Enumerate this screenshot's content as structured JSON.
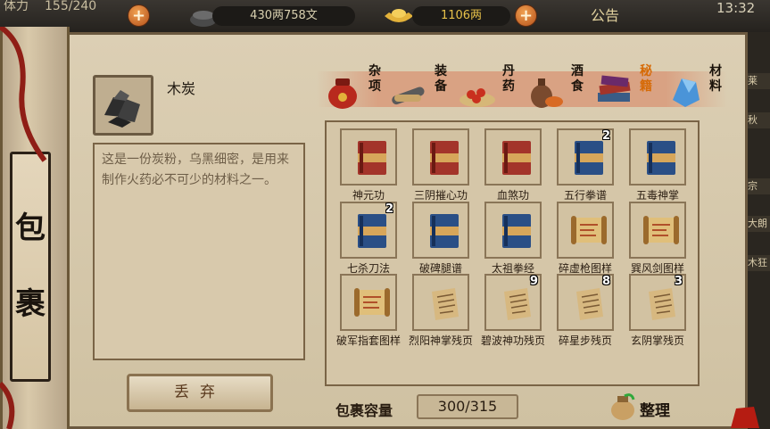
{
  "topbar": {
    "partial_label": "体力",
    "stamina": "155/240",
    "money": "430两758文",
    "ingots": "1106两",
    "notice_label": "公告",
    "clock": "13:32"
  },
  "scroll_title": [
    "包",
    "裹"
  ],
  "selected_item": {
    "name": "木炭",
    "description": "这是一份炭粉，乌黑细密，是用来制作火药必不可少的材料之一。"
  },
  "discard_label": "丢弃",
  "tabs": [
    {
      "label": "杂项",
      "icon": "red-jar-icon"
    },
    {
      "label": "装备",
      "icon": "scroll-bundle-icon"
    },
    {
      "label": "丹药",
      "icon": "pills-plate-icon"
    },
    {
      "label": "酒食",
      "icon": "wine-food-icon"
    },
    {
      "label": "秘籍",
      "icon": "manual-books-icon",
      "active": true
    },
    {
      "label": "材料",
      "icon": "blue-crystal-icon"
    }
  ],
  "items": [
    {
      "name": "神元功",
      "count": "",
      "type": "red-book"
    },
    {
      "name": "三阴摧心功",
      "count": "",
      "type": "red-book"
    },
    {
      "name": "血煞功",
      "count": "",
      "type": "red-book"
    },
    {
      "name": "五行拳谱",
      "count": "2",
      "type": "blue-book"
    },
    {
      "name": "五毒神掌",
      "count": "",
      "type": "blue-book"
    },
    {
      "name": "七杀刀法",
      "count": "2",
      "type": "blue-book"
    },
    {
      "name": "破碑腿谱",
      "count": "",
      "type": "blue-book"
    },
    {
      "name": "太祖拳经",
      "count": "",
      "type": "blue-book"
    },
    {
      "name": "碎虚枪图样",
      "count": "",
      "type": "scroll"
    },
    {
      "name": "巽风剑图样",
      "count": "",
      "type": "scroll"
    },
    {
      "name": "破军指套图样",
      "count": "",
      "type": "scroll"
    },
    {
      "name": "烈阳神掌残页",
      "count": "",
      "type": "page"
    },
    {
      "name": "碧波神功残页",
      "count": "9",
      "type": "page"
    },
    {
      "name": "碎星步残页",
      "count": "8",
      "type": "page"
    },
    {
      "name": "玄阴掌残页",
      "count": "3",
      "type": "page"
    }
  ],
  "capacity": {
    "label": "包裹容量",
    "value": "300/315"
  },
  "sort_label": "整理",
  "right_strip_labels": [
    "莱",
    "秋",
    "宗",
    "大朗",
    "木狂"
  ],
  "colors": {
    "active_tab": "#d66a06",
    "parchment": "#d5c6a8",
    "red_book": "#a3342a",
    "blue_book": "#2a4f86"
  }
}
